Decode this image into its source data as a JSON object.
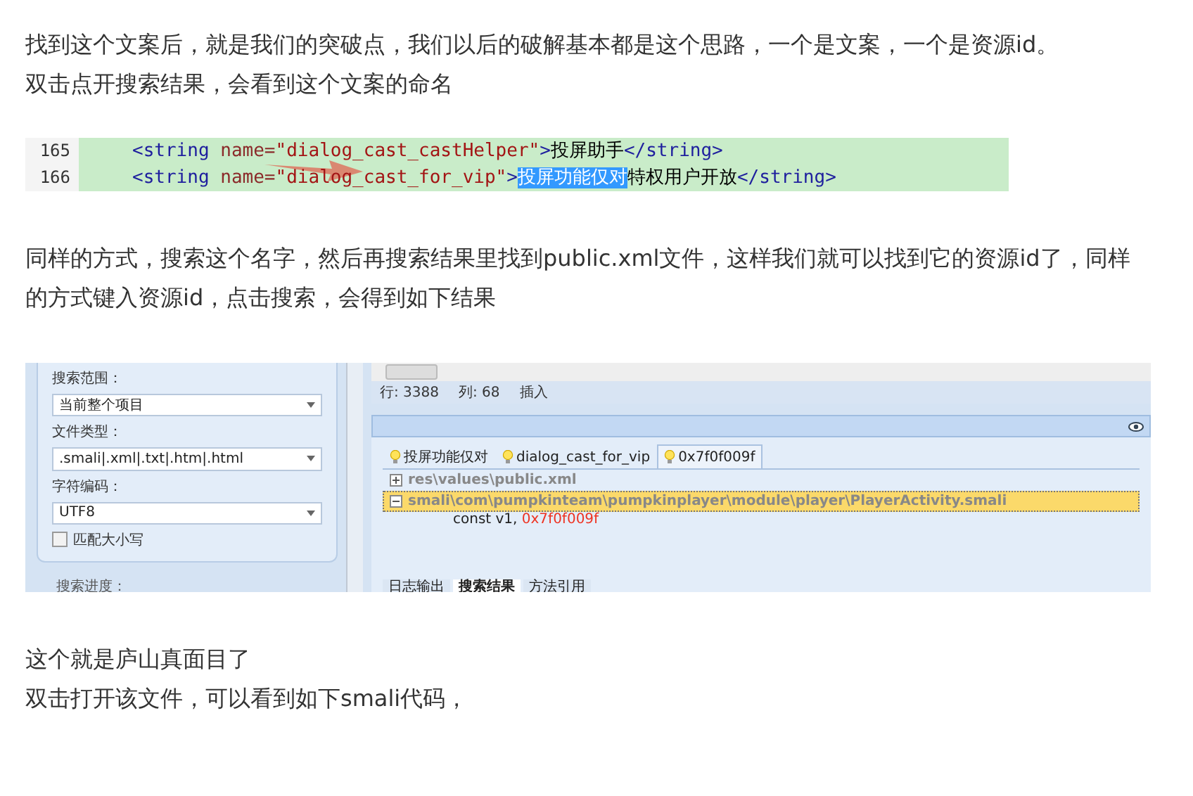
{
  "paragraphs_top": [
    "找到这个文案后，就是我们的突破点，我们以后的破解基本都是这个思路，一个是文案，一个是资源id。",
    "双击点开搜索结果，会看到这个文案的命名"
  ],
  "code_screenshot": {
    "lines": [
      {
        "number": "165",
        "parts": [
          {
            "kind": "tag",
            "text": "<string "
          },
          {
            "kind": "attr",
            "text": "name="
          },
          {
            "kind": "value",
            "text": "\"dialog_cast_castHelper\""
          },
          {
            "kind": "tag",
            "text": ">"
          },
          {
            "kind": "text",
            "text": "投屏助手"
          },
          {
            "kind": "tag",
            "text": "</string>"
          }
        ]
      },
      {
        "number": "166",
        "parts": [
          {
            "kind": "tag",
            "text": "<string "
          },
          {
            "kind": "attr",
            "text": "name="
          },
          {
            "kind": "value",
            "text": "\"dialog_cast_for_vip\""
          },
          {
            "kind": "tag",
            "text": ">"
          },
          {
            "kind": "selected",
            "text": "投屏功能仅对"
          },
          {
            "kind": "text",
            "text": "特权用户开放"
          },
          {
            "kind": "tag",
            "text": "</string>"
          }
        ]
      }
    ]
  },
  "paragraphs_middle": [
    "同样的方式，搜索这个名字，然后再搜索结果里找到public.xml文件，这样我们就可以找到它的资源id了，同样的方式键入资源id，点击搜索，会得到如下结果"
  ],
  "search_screenshot": {
    "fields": [
      {
        "label": "搜索范围：",
        "value": "当前整个项目"
      },
      {
        "label": "文件类型：",
        "value": ".smali|.xml|.txt|.htm|.html"
      },
      {
        "label": "字符编码：",
        "value": "UTF8"
      }
    ],
    "match_case": {
      "label": "匹配大小写",
      "checked": false
    },
    "progress_label": "搜索进度：",
    "status": [
      "行: 3388",
      "列: 68",
      "插入"
    ],
    "tabs": [
      {
        "label": "投屏功能仅对",
        "selected": false
      },
      {
        "label": "dialog_cast_for_vip",
        "selected": false
      },
      {
        "label": "0x7f0f009f",
        "selected": true
      }
    ],
    "results": [
      {
        "path": "res\\values\\public.xml",
        "expanded": false,
        "selected": false
      },
      {
        "path": "smali\\com\\pumpkinteam\\pumpkinplayer\\module\\player\\PlayerActivity.smali",
        "expanded": true,
        "selected": true,
        "children": [
          {
            "code": "const v1, ",
            "match": "0x7f0f009f"
          }
        ]
      }
    ],
    "bottom_tabs": [
      {
        "label": "日志输出",
        "selected": false
      },
      {
        "label": "搜索结果",
        "selected": true
      },
      {
        "label": "方法引用",
        "selected": false
      }
    ]
  },
  "paragraphs_bottom": [
    "这个就是庐山真面目了",
    "双击打开该文件，可以看到如下smali代码，"
  ]
}
